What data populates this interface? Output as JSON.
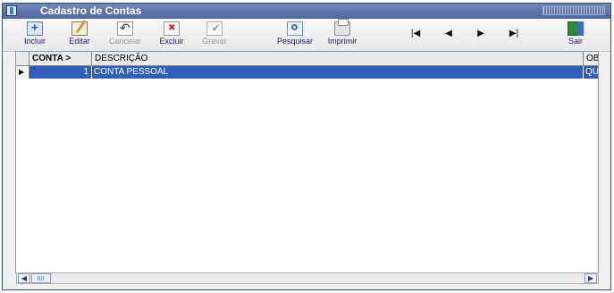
{
  "window": {
    "title": "Cadastro de Contas"
  },
  "toolbar": {
    "incluir": "Incluir",
    "editar": "Editar",
    "cancelar": "Cancelar",
    "excluir": "Excluir",
    "gravar": "Gravar",
    "pesquisar": "Pesquisar",
    "imprimir": "Imprimir",
    "nav_first": "|◀",
    "nav_prev": "◀",
    "nav_next": "▶",
    "nav_last": "▶|",
    "sair": "Sair"
  },
  "grid": {
    "columns": [
      "CONTA >",
      "DESCRIÇÃO",
      "OB"
    ],
    "rows": [
      {
        "conta": "1",
        "descricao": "CONTA PESSOAL",
        "obs": "QU"
      }
    ],
    "row_indicator": "▶"
  },
  "colors": {
    "title_bar": "#5a73a8",
    "selection": "#2f5fb8",
    "background": "#f0f0f0"
  },
  "scrollbar": {
    "left": "◀",
    "right": "▶"
  }
}
